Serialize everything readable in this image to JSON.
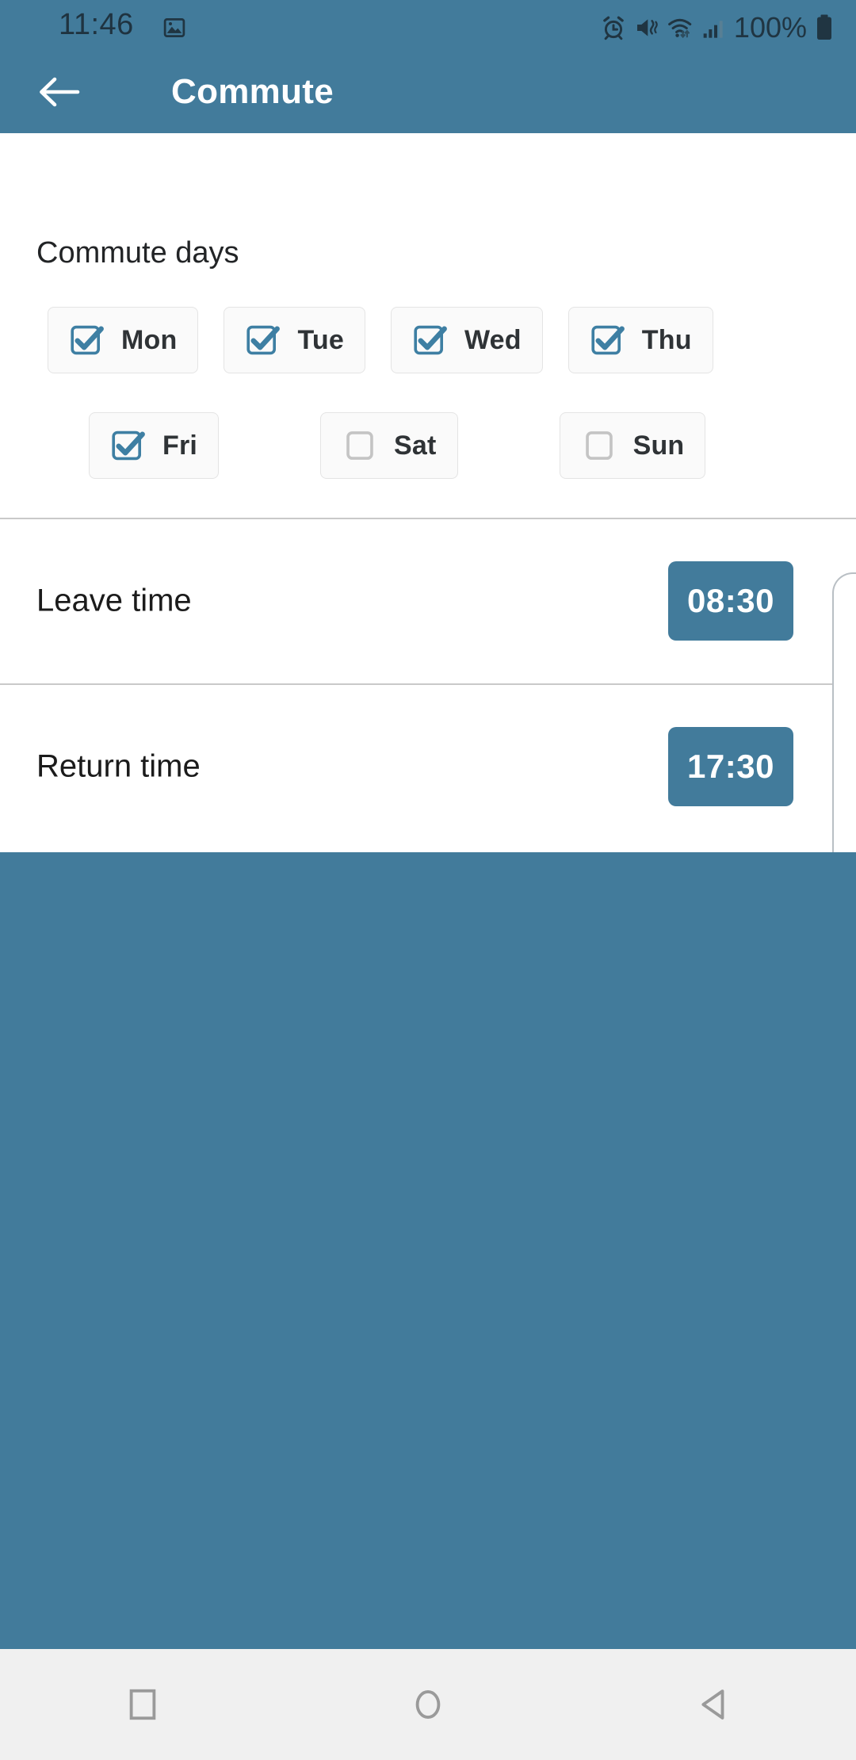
{
  "statusbar": {
    "time": "11:46",
    "battery_pct": "100%",
    "icons": [
      "image-icon",
      "alarm-icon",
      "vibrate-mute-icon",
      "wifi-icon",
      "cellular-signal-icon",
      "battery-icon"
    ]
  },
  "appbar": {
    "title": "Commute",
    "back_icon": "arrow-left-icon",
    "background_color": "#427B9B",
    "title_color": "#FFFFFF"
  },
  "content": {
    "section_title": "Commute days",
    "days": [
      {
        "label": "Mon",
        "checked": true
      },
      {
        "label": "Tue",
        "checked": true
      },
      {
        "label": "Wed",
        "checked": true
      },
      {
        "label": "Thu",
        "checked": true
      },
      {
        "label": "Fri",
        "checked": true
      },
      {
        "label": "Sat",
        "checked": false
      },
      {
        "label": "Sun",
        "checked": false
      }
    ],
    "time_rows": [
      {
        "label": "Leave time",
        "value": "08:30"
      },
      {
        "label": "Return time",
        "value": "17:30"
      }
    ]
  },
  "theme": {
    "accent": "#427B9B",
    "checkbox_checked": "#3E7FA3",
    "checkbox_unchecked": "#C4C4C4",
    "sheet_background": "#FFFFFF",
    "divider": "#C9C9C9",
    "chip_background": "#FAFAFA"
  },
  "navbar": {
    "buttons": [
      {
        "name": "recents",
        "icon": "square-icon"
      },
      {
        "name": "home",
        "icon": "circle-icon"
      },
      {
        "name": "back",
        "icon": "triangle-left-icon"
      }
    ]
  }
}
